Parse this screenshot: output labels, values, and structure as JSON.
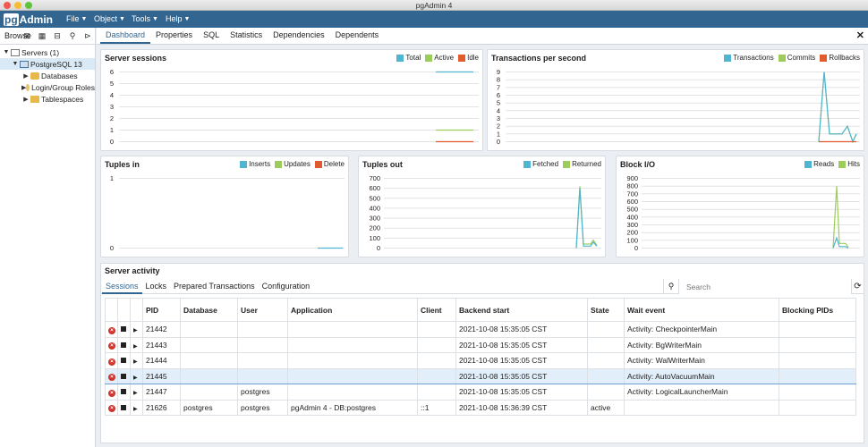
{
  "window": {
    "title": "pgAdmin 4"
  },
  "menubar": {
    "logo_pg": "pg",
    "logo_rest": "Admin",
    "items": [
      {
        "label": "File"
      },
      {
        "label": "Object"
      },
      {
        "label": "Tools"
      },
      {
        "label": "Help"
      }
    ]
  },
  "browser": {
    "label": "Browser",
    "tree": [
      {
        "label": "Servers (1)",
        "level": 0
      },
      {
        "label": "PostgreSQL 13",
        "level": 1
      },
      {
        "label": "Databases",
        "level": 2
      },
      {
        "label": "Login/Group Roles",
        "level": 2
      },
      {
        "label": "Tablespaces",
        "level": 2
      }
    ]
  },
  "tabs": [
    {
      "label": "Dashboard",
      "active": true
    },
    {
      "label": "Properties"
    },
    {
      "label": "SQL"
    },
    {
      "label": "Statistics"
    },
    {
      "label": "Dependencies"
    },
    {
      "label": "Dependents"
    }
  ],
  "colors": {
    "teal": "#4fb5d0",
    "green": "#9ccd5a",
    "orange": "#e05c2c",
    "accent": "#326690"
  },
  "charts": {
    "server_sessions": {
      "title": "Server sessions",
      "legend": [
        "Total",
        "Active",
        "Idle"
      ],
      "yticks": [
        "6",
        "5",
        "4",
        "3",
        "2",
        "1",
        "0"
      ]
    },
    "tps": {
      "title": "Transactions per second",
      "legend": [
        "Transactions",
        "Commits",
        "Rollbacks"
      ],
      "yticks": [
        "9",
        "8",
        "7",
        "6",
        "5",
        "4",
        "3",
        "2",
        "1",
        "0"
      ]
    },
    "tuples_in": {
      "title": "Tuples in",
      "legend": [
        "Inserts",
        "Updates",
        "Delete"
      ],
      "yticks": [
        "1",
        "0"
      ]
    },
    "tuples_out": {
      "title": "Tuples out",
      "legend": [
        "Fetched",
        "Returned"
      ],
      "yticks": [
        "700",
        "600",
        "500",
        "400",
        "300",
        "200",
        "100",
        "0"
      ]
    },
    "block_io": {
      "title": "Block I/O",
      "legend": [
        "Reads",
        "Hits"
      ],
      "yticks": [
        "900",
        "800",
        "700",
        "600",
        "500",
        "400",
        "300",
        "200",
        "100",
        "0"
      ]
    }
  },
  "chart_data": [
    {
      "type": "line",
      "title": "Server sessions",
      "ylim": [
        0,
        6
      ],
      "series": [
        {
          "name": "Total",
          "values": [
            6,
            6,
            6,
            6,
            6
          ]
        },
        {
          "name": "Active",
          "values": [
            1,
            1,
            1,
            1,
            1
          ]
        },
        {
          "name": "Idle",
          "values": [
            0,
            0,
            0,
            0,
            0
          ]
        }
      ]
    },
    {
      "type": "line",
      "title": "Transactions per second",
      "ylim": [
        0,
        9
      ],
      "series": [
        {
          "name": "Transactions",
          "values": [
            0,
            9,
            1,
            1,
            1,
            2,
            0,
            1
          ]
        },
        {
          "name": "Commits",
          "values": [
            0,
            9,
            1,
            1,
            1,
            2,
            0,
            1
          ]
        },
        {
          "name": "Rollbacks",
          "values": [
            0,
            0,
            0,
            0,
            0,
            0,
            0,
            0
          ]
        }
      ]
    },
    {
      "type": "line",
      "title": "Tuples in",
      "ylim": [
        0,
        1
      ],
      "series": [
        {
          "name": "Inserts",
          "values": [
            0,
            0,
            0
          ]
        },
        {
          "name": "Updates",
          "values": [
            0,
            0,
            0
          ]
        },
        {
          "name": "Delete",
          "values": [
            0,
            0,
            0
          ]
        }
      ]
    },
    {
      "type": "line",
      "title": "Tuples out",
      "ylim": [
        0,
        700
      ],
      "series": [
        {
          "name": "Fetched",
          "values": [
            0,
            600,
            20,
            20,
            60,
            20
          ]
        },
        {
          "name": "Returned",
          "values": [
            0,
            620,
            40,
            40,
            80,
            30
          ]
        }
      ]
    },
    {
      "type": "line",
      "title": "Block I/O",
      "ylim": [
        0,
        900
      ],
      "series": [
        {
          "name": "Reads",
          "values": [
            0,
            130,
            20,
            20,
            0
          ]
        },
        {
          "name": "Hits",
          "values": [
            0,
            800,
            60,
            60,
            10
          ]
        }
      ]
    }
  ],
  "activity": {
    "title": "Server activity",
    "subtabs": [
      {
        "label": "Sessions",
        "active": true
      },
      {
        "label": "Locks"
      },
      {
        "label": "Prepared Transactions"
      },
      {
        "label": "Configuration"
      }
    ],
    "search_placeholder": "Search",
    "columns": [
      "PID",
      "Database",
      "User",
      "Application",
      "Client",
      "Backend start",
      "State",
      "Wait event",
      "Blocking PIDs"
    ],
    "rows": [
      [
        "21442",
        "",
        "",
        "",
        "",
        "2021-10-08 15:35:05 CST",
        "",
        "Activity: CheckpointerMain",
        ""
      ],
      [
        "21443",
        "",
        "",
        "",
        "",
        "2021-10-08 15:35:05 CST",
        "",
        "Activity: BgWriterMain",
        ""
      ],
      [
        "21444",
        "",
        "",
        "",
        "",
        "2021-10-08 15:35:05 CST",
        "",
        "Activity: WalWriterMain",
        ""
      ],
      [
        "21445",
        "",
        "",
        "",
        "",
        "2021-10-08 15:35:05 CST",
        "",
        "Activity: AutoVacuumMain",
        ""
      ],
      [
        "21447",
        "",
        "postgres",
        "",
        "",
        "2021-10-08 15:35:05 CST",
        "",
        "Activity: LogicalLauncherMain",
        ""
      ],
      [
        "21626",
        "postgres",
        "postgres",
        "pgAdmin 4 - DB:postgres",
        "::1",
        "2021-10-08 15:36:39 CST",
        "active",
        "",
        ""
      ]
    ],
    "selected_row": 3
  }
}
